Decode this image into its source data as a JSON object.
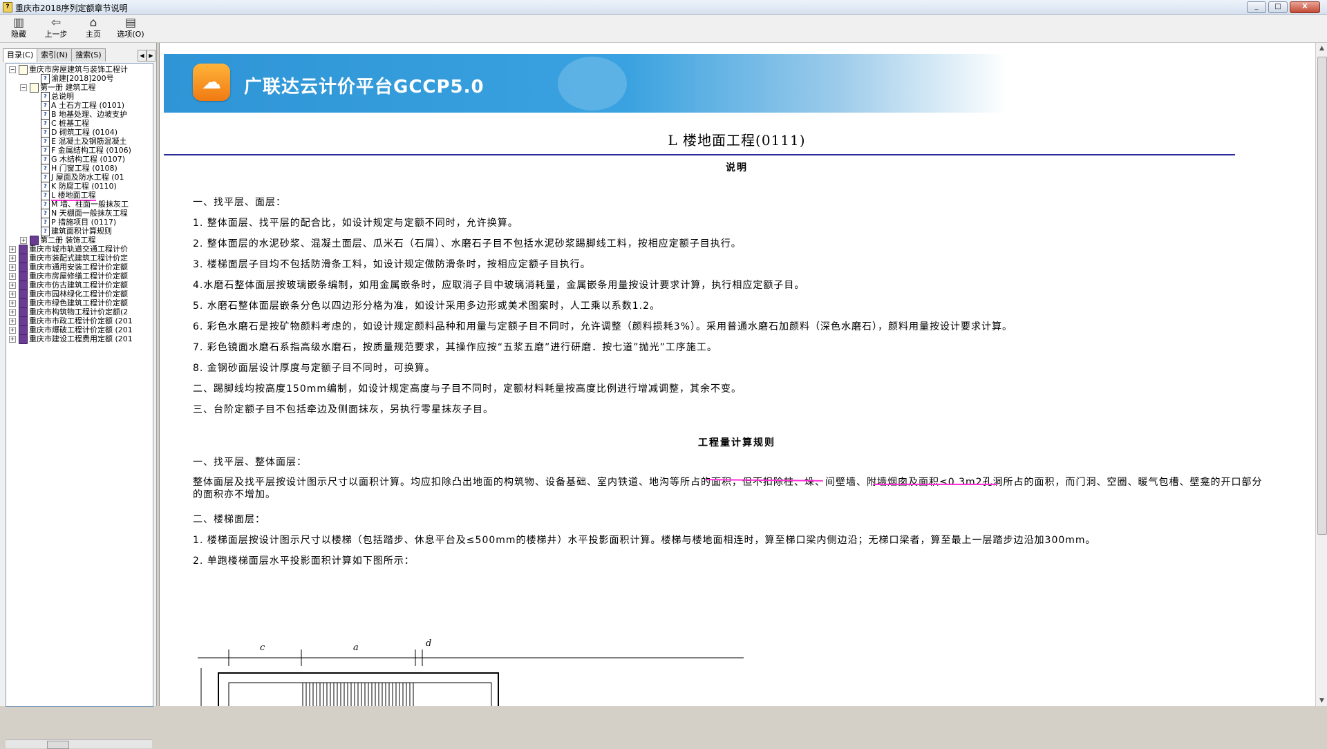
{
  "window": {
    "title": "重庆市2018序列定额章节说明",
    "buttons": [
      "_",
      "□",
      "X"
    ]
  },
  "toolbar": {
    "hide": "隐藏",
    "back": "上一步",
    "home": "主页",
    "options": "选项(O)"
  },
  "tabs": {
    "contents": "目录(C)",
    "index": "索引(N)",
    "search": "搜索(S)"
  },
  "tree": [
    {
      "label": "重庆市房屋建筑与装饰工程计",
      "toggle": "−",
      "icon": "obook"
    },
    {
      "label": "渝建[2018]200号",
      "icon": "page"
    },
    {
      "label": "第一册 建筑工程",
      "toggle": "−",
      "icon": "obook"
    },
    {
      "label": "总说明",
      "icon": "page"
    },
    {
      "label": "A 土石方工程 (0101)",
      "icon": "page"
    },
    {
      "label": "B 地基处理、边坡支护",
      "icon": "page"
    },
    {
      "label": "C 桩基工程",
      "icon": "page"
    },
    {
      "label": "D 砌筑工程 (0104)",
      "icon": "page"
    },
    {
      "label": "E 混凝土及钢筋混凝土",
      "icon": "page"
    },
    {
      "label": "F 金属结构工程 (0106)",
      "icon": "page"
    },
    {
      "label": "G 木结构工程 (0107)",
      "icon": "page"
    },
    {
      "label": "H 门窗工程 (0108)",
      "icon": "page"
    },
    {
      "label": "J 屋面及防水工程 (01",
      "icon": "page"
    },
    {
      "label": "K 防腐工程 (0110)",
      "icon": "page"
    },
    {
      "label": "L 楼地面工程",
      "icon": "page",
      "selected": true
    },
    {
      "label": "M 墙、柱面一般抹灰工",
      "icon": "page"
    },
    {
      "label": "N 天棚面一般抹灰工程",
      "icon": "page"
    },
    {
      "label": "P 措施项目 (0117)",
      "icon": "page"
    },
    {
      "label": "建筑面积计算规则",
      "icon": "page"
    },
    {
      "label": "第二册 装饰工程",
      "toggle": "+",
      "icon": "book"
    },
    {
      "label": "重庆市城市轨道交通工程计价",
      "toggle": "+",
      "icon": "book"
    },
    {
      "label": "重庆市装配式建筑工程计价定",
      "toggle": "+",
      "icon": "book"
    },
    {
      "label": "重庆市通用安装工程计价定额",
      "toggle": "+",
      "icon": "book"
    },
    {
      "label": "重庆市房屋修缮工程计价定额",
      "toggle": "+",
      "icon": "book"
    },
    {
      "label": "重庆市仿古建筑工程计价定额",
      "toggle": "+",
      "icon": "book"
    },
    {
      "label": "重庆市园林绿化工程计价定额",
      "toggle": "+",
      "icon": "book"
    },
    {
      "label": "重庆市绿色建筑工程计价定额",
      "toggle": "+",
      "icon": "book"
    },
    {
      "label": "重庆市构筑物工程计价定额(2",
      "toggle": "+",
      "icon": "book"
    },
    {
      "label": "重庆市市政工程计价定额 (201",
      "toggle": "+",
      "icon": "book"
    },
    {
      "label": "重庆市爆破工程计价定额 (201",
      "toggle": "+",
      "icon": "book"
    },
    {
      "label": "重庆市建设工程费用定额 (201",
      "toggle": "+",
      "icon": "book"
    }
  ],
  "banner": {
    "title": "广联达云计价平台GCCP5.0"
  },
  "doc": {
    "title": "L  楼地面工程(0111)",
    "sub1": "说明",
    "paragraphs1": [
      "一、找平层、面层：",
      "1. 整体面层、找平层的配合比，如设计规定与定额不同时，允许换算。",
      "2. 整体面层的水泥砂浆、混凝土面层、瓜米石（石屑）、水磨石子目不包括水泥砂浆踢脚线工料，按相应定额子目执行。",
      "3. 楼梯面层子目均不包括防滑条工料，如设计规定做防滑条时，按相应定额子目执行。",
      "4.水磨石整体面层按玻璃嵌条编制，如用金属嵌条时，应取消子目中玻璃消耗量，金属嵌条用量按设计要求计算，执行相应定额子目。",
      "5. 水磨石整体面层嵌条分色以四边形分格为准，如设计采用多边形或美术图案时，人工乘以系数1.2。",
      "6. 彩色水磨石是按矿物颜料考虑的，如设计规定颜料品种和用量与定额子目不同时，允许调整（颜料损耗3%）。采用普通水磨石加颜料（深色水磨石），颜料用量按设计要求计算。",
      "7. 彩色镜面水磨石系指高级水磨石，按质量规范要求，其操作应按“五浆五磨”进行研磨．按七道”抛光”工序施工。",
      "8. 金钢砂面层设计厚度与定额子目不同时，可换算。",
      "二、踢脚线均按高度150mm编制，如设计规定高度与子目不同时，定额材料耗量按高度比例进行增减调整，其余不变。",
      "三、台阶定额子目不包括牵边及侧面抹灰，另执行零星抹灰子目。"
    ],
    "sub2": "工程量计算规则",
    "paragraphs2": [
      "一、找平层、整体面层：",
      "整体面层及找平层按设计图示尺寸以面积计算。均应扣除凸出地面的构筑物、设备基础、室内铁道、地沟等所占的面积，但不扣除柱、垛、间壁墙、附墙烟囱及面积≤0.3m2孔洞所占的面积，而门洞、空圈、暖气包槽、壁龛的开口部分的面积亦不增加。",
      "二、楼梯面层：",
      "1. 楼梯面层按设计图示尺寸以楼梯（包括踏步、休息平台及≤500mm的楼梯井）水平投影面积计算。楼梯与楼地面相连时，算至梯口梁内侧边沿；无梯口梁者，算至最上一层踏步边沿加300mm。",
      "2. 单跑楼梯面层水平投影面积计算如下图所示："
    ],
    "figure_labels": {
      "c": "c",
      "a": "a",
      "d": "d"
    }
  }
}
